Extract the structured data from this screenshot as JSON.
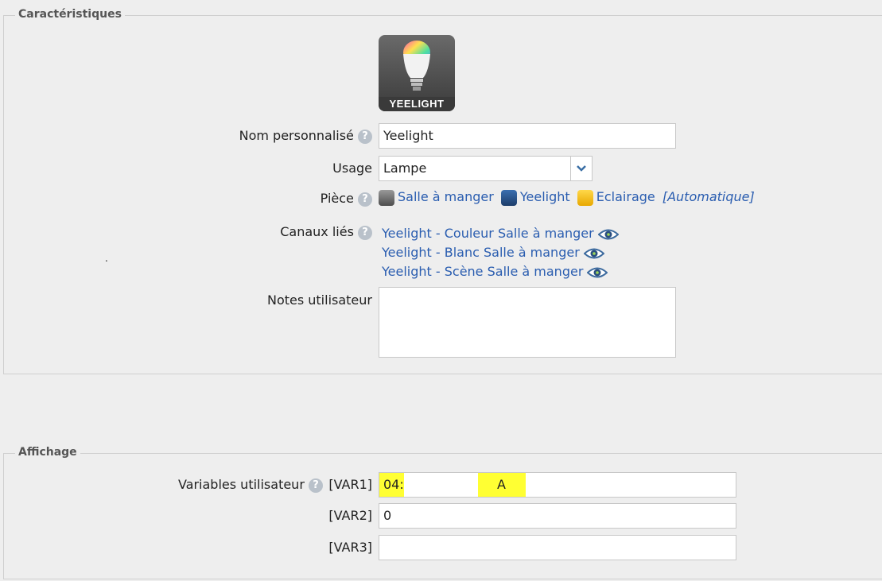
{
  "caracteristiques": {
    "legend": "Caractéristiques",
    "logo_text": "YEELIGHT",
    "nom_label": "Nom personnalisé",
    "nom_value": "Yeelight",
    "usage_label": "Usage",
    "usage_value": "Lampe",
    "piece_label": "Pièce",
    "piece_links": [
      "Salle à manger",
      "Yeelight",
      "Eclairage"
    ],
    "piece_auto": "[Automatique]",
    "canaux_label": "Canaux liés",
    "canaux": [
      "Yeelight - Couleur Salle à manger",
      "Yeelight - Blanc Salle à manger",
      "Yeelight - Scène Salle à manger"
    ],
    "notes_label": "Notes utilisateur",
    "notes_value": "",
    "dot": "."
  },
  "affichage": {
    "legend": "Affichage",
    "vars_label": "Variables utilisateur",
    "vars": [
      {
        "name": "[VAR1]",
        "value_prefix": "04:",
        "value_suffix": "A"
      },
      {
        "name": "[VAR2]",
        "value": "0"
      },
      {
        "name": "[VAR3]",
        "value": ""
      }
    ]
  },
  "colors": {
    "link": "#2a5db0",
    "highlight": "#ffff33",
    "background": "#eeeeee"
  }
}
